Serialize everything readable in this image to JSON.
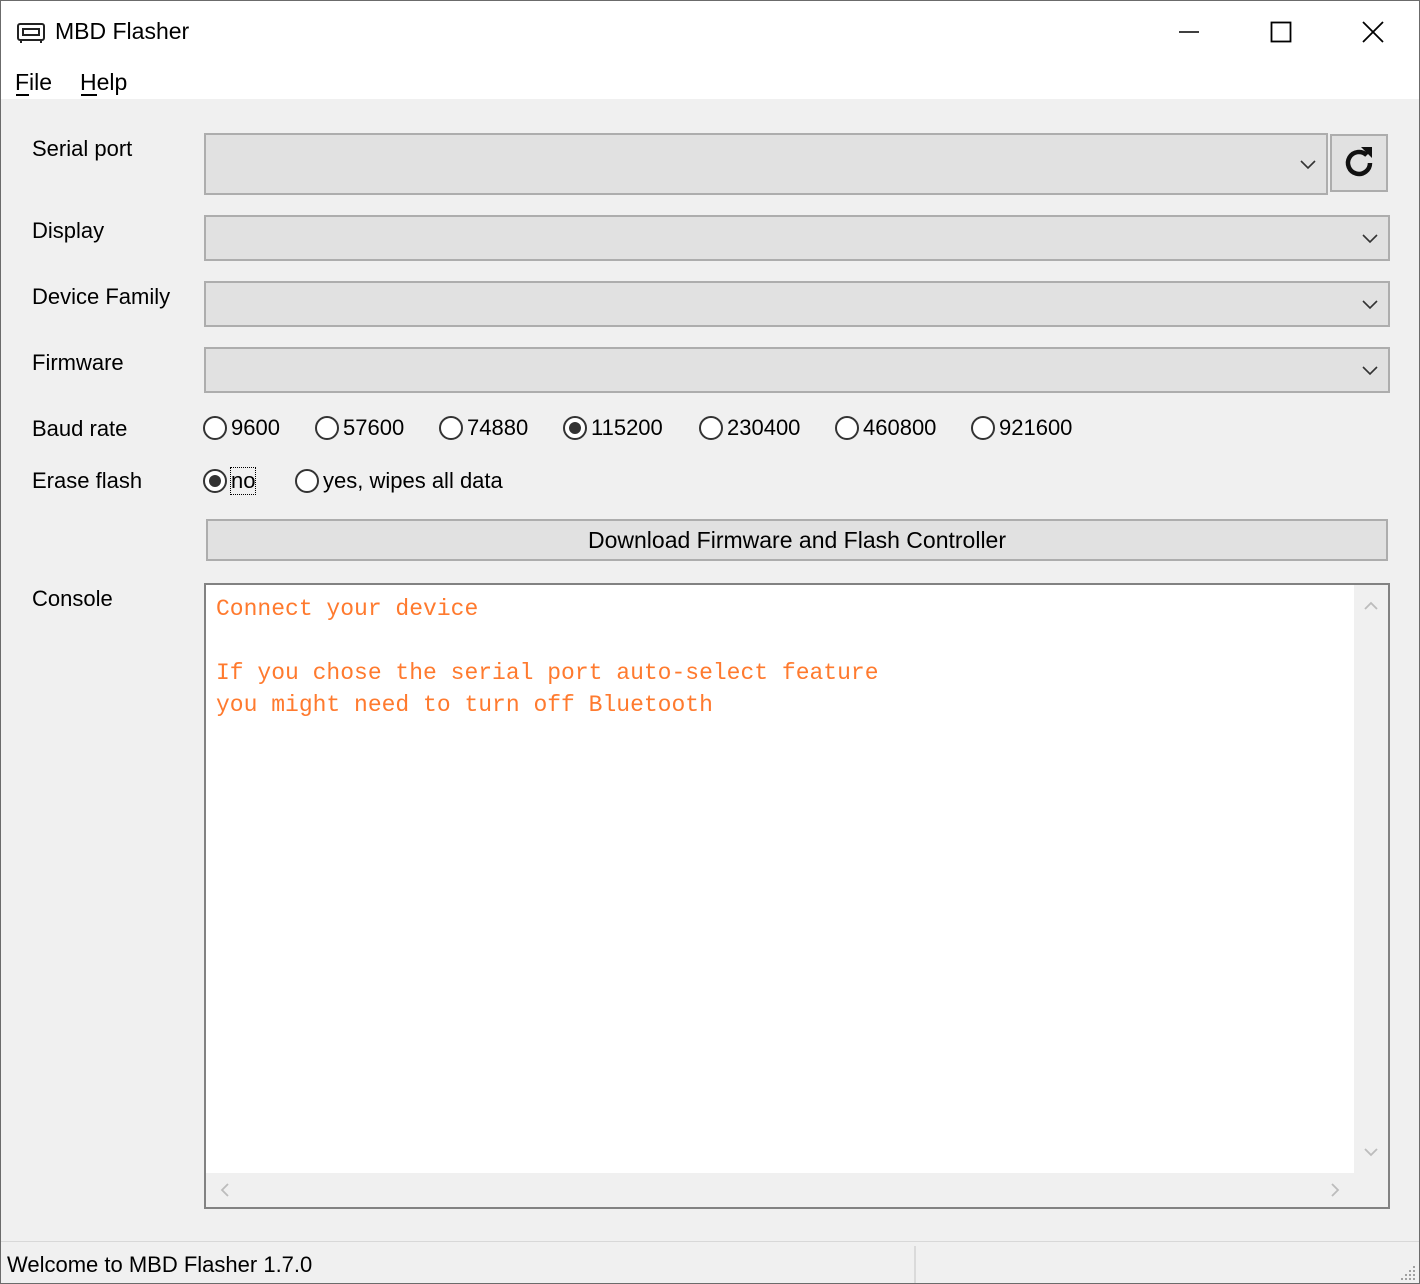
{
  "window": {
    "title": "MBD Flasher"
  },
  "menu": {
    "file": "File",
    "help": "Help"
  },
  "form": {
    "serial_port_label": "Serial port",
    "display_label": "Display",
    "device_family_label": "Device Family",
    "firmware_label": "Firmware",
    "baud_rate_label": "Baud rate",
    "erase_flash_label": "Erase flash",
    "console_label": "Console",
    "serial_port_value": "",
    "display_value": "",
    "device_family_value": "",
    "firmware_value": ""
  },
  "baud_rates": [
    "9600",
    "57600",
    "74880",
    "115200",
    "230400",
    "460800",
    "921600"
  ],
  "baud_selected": "115200",
  "erase_options": {
    "no": "no",
    "yes": "yes, wipes all data",
    "selected": "no"
  },
  "action_button": "Download Firmware and Flash Controller",
  "console": {
    "line1": "Connect your device",
    "line2": "",
    "line3": "If you chose the serial port auto-select feature",
    "line4": "you might need to turn off Bluetooth",
    "text_color": "#ff7a2e"
  },
  "status": {
    "message": "Welcome to MBD Flasher 1.7.0"
  }
}
